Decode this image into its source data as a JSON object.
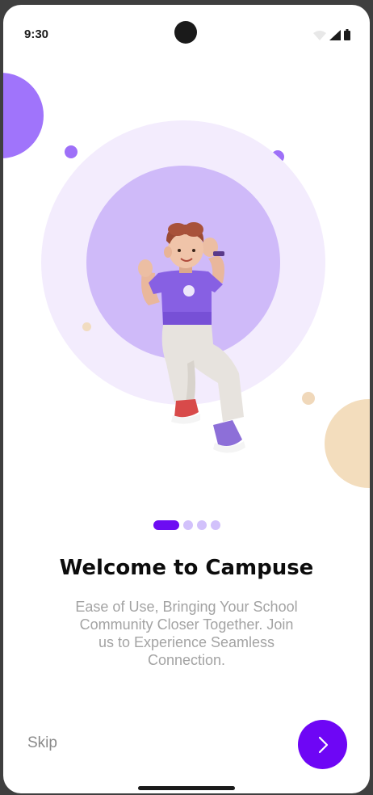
{
  "status_bar": {
    "time": "9:30",
    "icons": [
      "wifi-icon",
      "signal-icon",
      "battery-icon"
    ]
  },
  "onboarding": {
    "illustration": "boy-character-illustration",
    "pager": {
      "total": 4,
      "active_index": 0
    },
    "title": "Welcome to Campuse",
    "subtitle_lines": [
      "Ease of Use, Bringing Your School",
      "Community Closer Together. Join",
      "us to Experience Seamless",
      "Connection."
    ],
    "skip_label": "Skip",
    "next_icon": "chevron-right-icon"
  },
  "colors": {
    "accent": "#6e06f5",
    "pager_inactive": "#d2c1fb",
    "light_purple": "#cfbaf9",
    "peach": "#f3ddbd"
  }
}
